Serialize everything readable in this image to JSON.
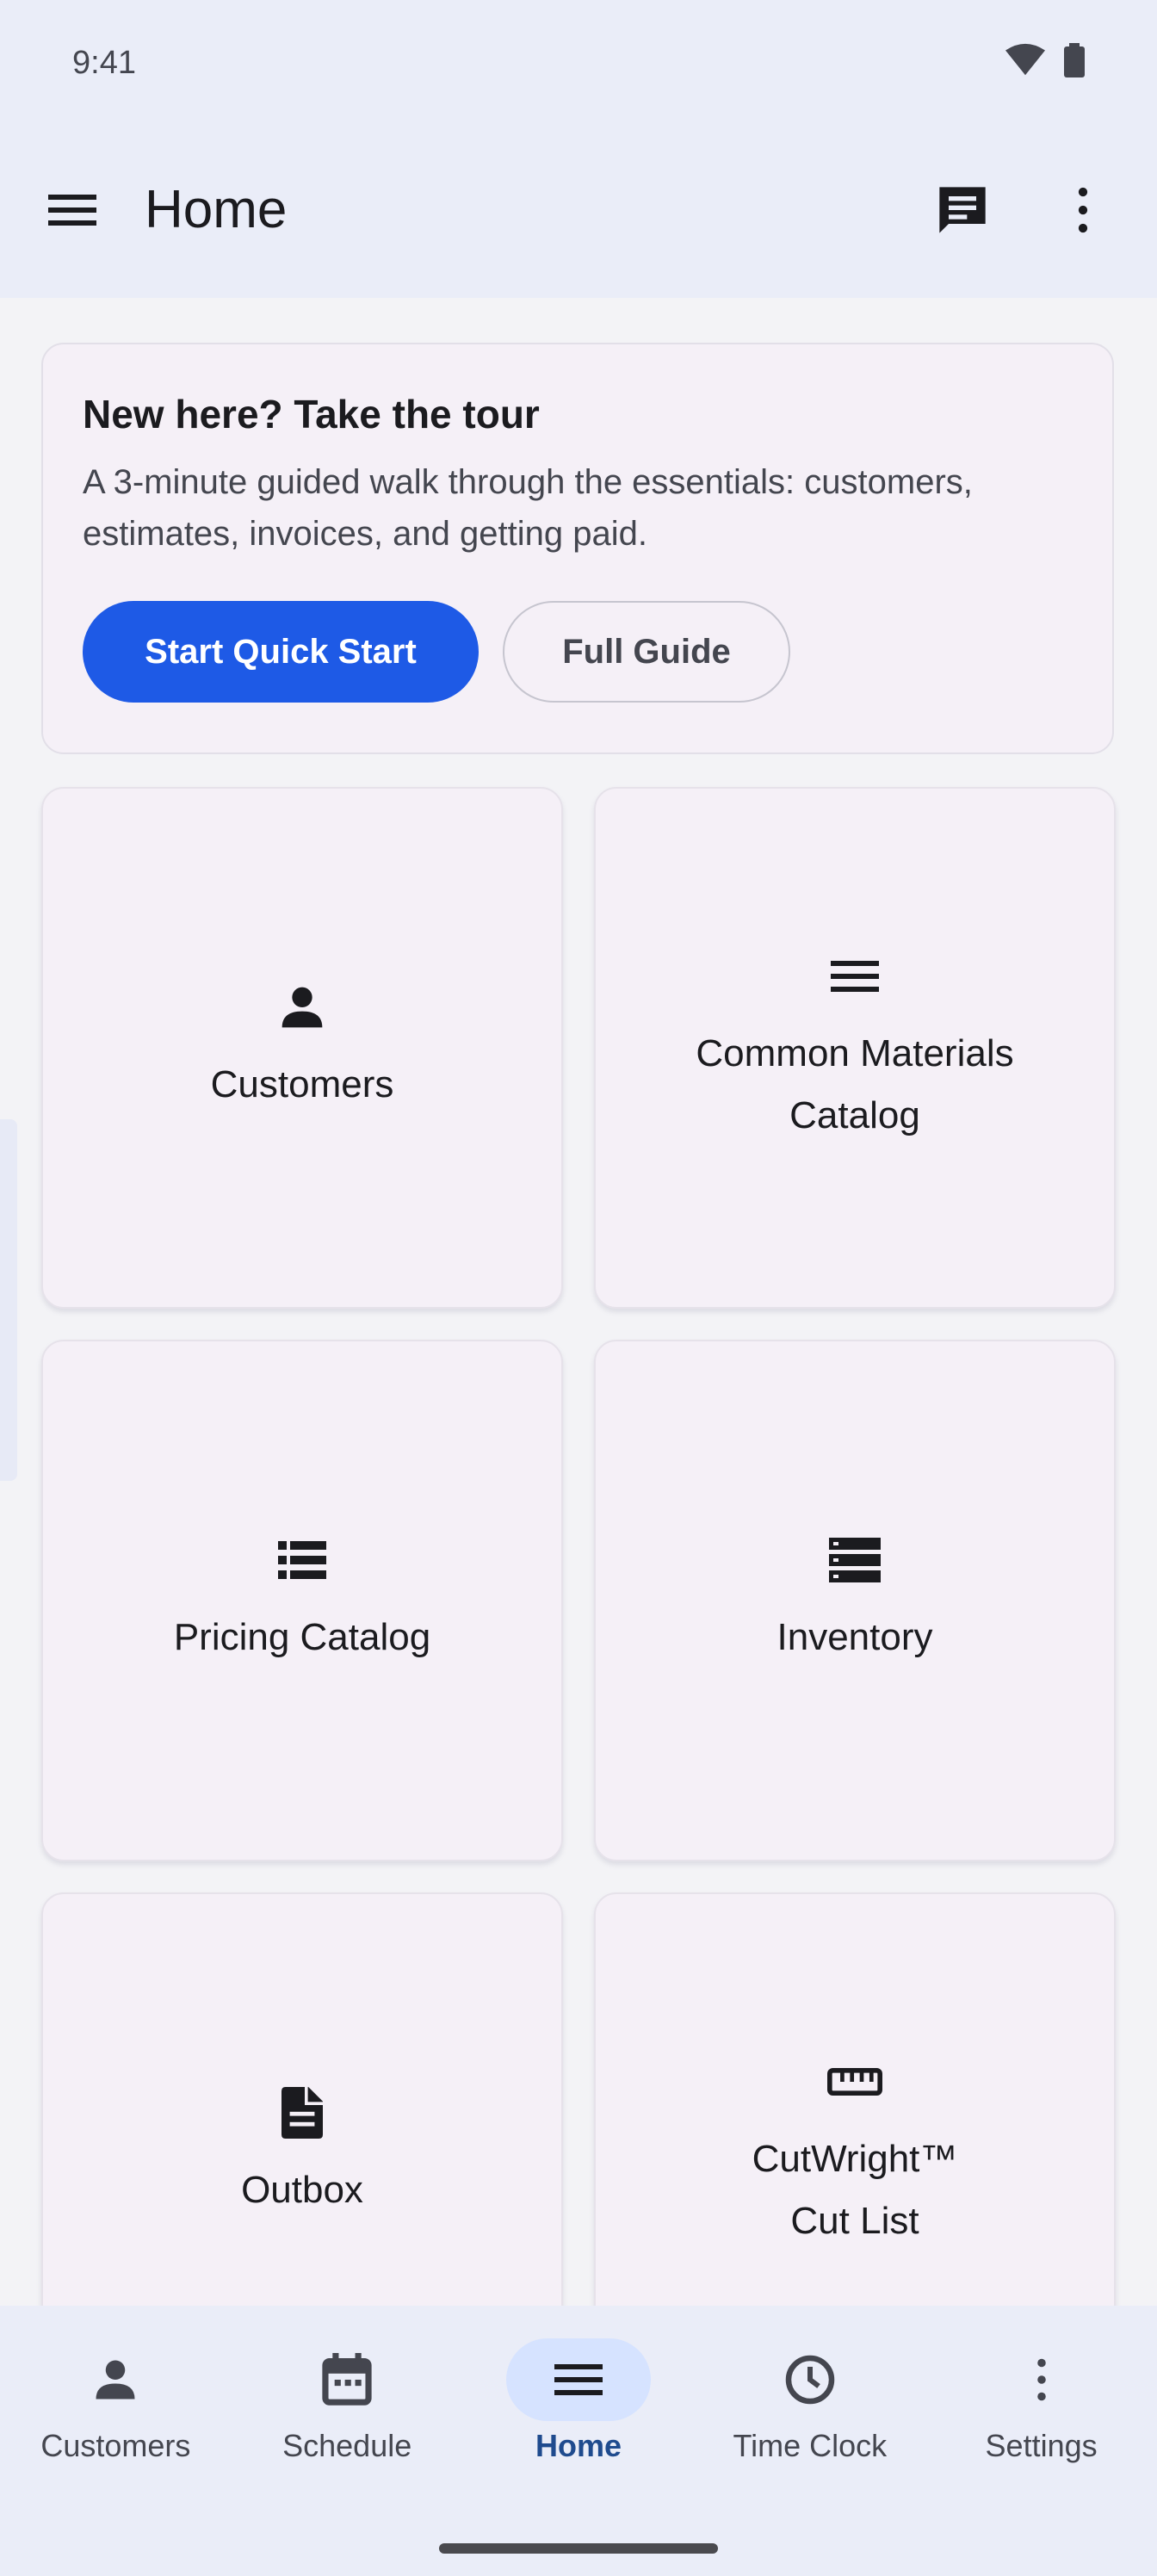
{
  "status": {
    "time": "9:41",
    "icons": [
      "wifi-icon",
      "battery-icon"
    ]
  },
  "app_bar": {
    "title": "Home",
    "icons": [
      "menu-icon",
      "chat-icon",
      "more-vert-icon"
    ]
  },
  "tour_card": {
    "title": "New here? Take the tour",
    "description": "A 3-minute guided walk through the essentials: customers, estimates, invoices, and getting paid.",
    "primary_button": "Start Quick Start",
    "secondary_button": "Full Guide"
  },
  "tiles": [
    {
      "label": "Customers",
      "icon": "person-icon"
    },
    {
      "label": "Common Materials\nCatalog",
      "icon": "list-lines-icon"
    },
    {
      "label": "Pricing Catalog",
      "icon": "list-bulleted-icon"
    },
    {
      "label": "Inventory",
      "icon": "storage-icon"
    },
    {
      "label": "Outbox",
      "icon": "document-icon"
    },
    {
      "label": "CutWright™\nCut List",
      "icon": "ruler-icon"
    }
  ],
  "bottom_nav": [
    {
      "label": "Customers",
      "icon": "person-icon",
      "active": false
    },
    {
      "label": "Schedule",
      "icon": "calendar-icon",
      "active": false
    },
    {
      "label": "Home",
      "icon": "menu-icon",
      "active": true
    },
    {
      "label": "Time Clock",
      "icon": "clock-icon",
      "active": false
    },
    {
      "label": "Settings",
      "icon": "more-vert-icon",
      "active": false
    }
  ],
  "colors": {
    "primary": "#1e5ae6",
    "surface": "#eaedf8",
    "card": "#f5f0f7",
    "active_nav_pill": "#d6e3ff",
    "active_nav_text": "#1f4b8e"
  }
}
